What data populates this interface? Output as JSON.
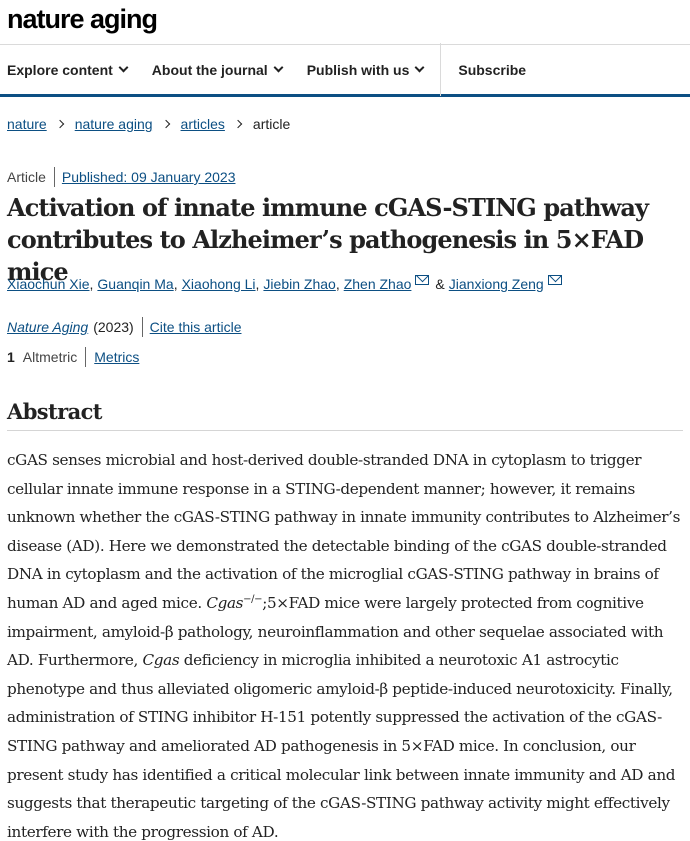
{
  "header": {
    "logo": "nature aging"
  },
  "nav": {
    "items": [
      "Explore content",
      "About the journal",
      "Publish with us"
    ],
    "subscribe": "Subscribe"
  },
  "breadcrumb": {
    "items": [
      "nature",
      "nature aging",
      "articles"
    ],
    "current": "article"
  },
  "article": {
    "type": "Article",
    "published": "Published: 09 January 2023",
    "title": "Activation of innate immune cGAS-STING pathway contributes to Alzheimer’s pathogenesis in 5×FAD mice",
    "authors": [
      "Xiaochun Xie",
      "Guanqin Ma",
      "Xiaohong Li",
      "Jiebin Zhao",
      "Zhen Zhao",
      "Jianxiong Zeng"
    ],
    "author_separator": ",",
    "author_and": "&",
    "journal": "Nature Aging",
    "year": "(2023)",
    "cite": "Cite this article",
    "altmetric_count": "1",
    "altmetric_label": "Altmetric",
    "metrics": "Metrics"
  },
  "abstract": {
    "heading": "Abstract",
    "part1": "cGAS senses microbial and host-derived double-stranded DNA in cytoplasm to trigger cellular innate immune response in a STING-dependent manner; however, it remains unknown whether the cGAS-STING pathway in innate immunity contributes to Alzheimer’s disease (AD). Here we demonstrated the detectable binding of the cGAS double-stranded DNA in cytoplasm and the activation of the microglial cGAS-STING pathway in brains of human AD and aged mice. ",
    "gene1": "Cgas",
    "sup1": "−/−",
    "part2": ";5×FAD mice were largely protected from cognitive impairment, amyloid-β pathology, neuroinflammation and other sequelae associated with AD. Furthermore, ",
    "gene2": "Cgas",
    "part3": " deficiency in microglia inhibited a neurotoxic A1 astrocytic phenotype and thus alleviated oligomeric amyloid-β peptide-induced neurotoxicity. Finally, administration of STING inhibitor H-151 potently suppressed the activation of the cGAS-STING pathway and ameliorated AD pathogenesis in 5×FAD mice. In conclusion, our present study has identified a critical molecular link between innate immunity and AD and suggests that therapeutic targeting of the cGAS-STING pathway activity might effectively interfere with the progression of AD."
  },
  "icons": {
    "chevron": "chevron-down-icon",
    "breadcrumb_sep": "chevron-right-icon",
    "mail": "envelope-icon"
  },
  "colors": {
    "link": "#0c4f83",
    "accent_bar": "#0c4f83",
    "text": "#222222"
  }
}
